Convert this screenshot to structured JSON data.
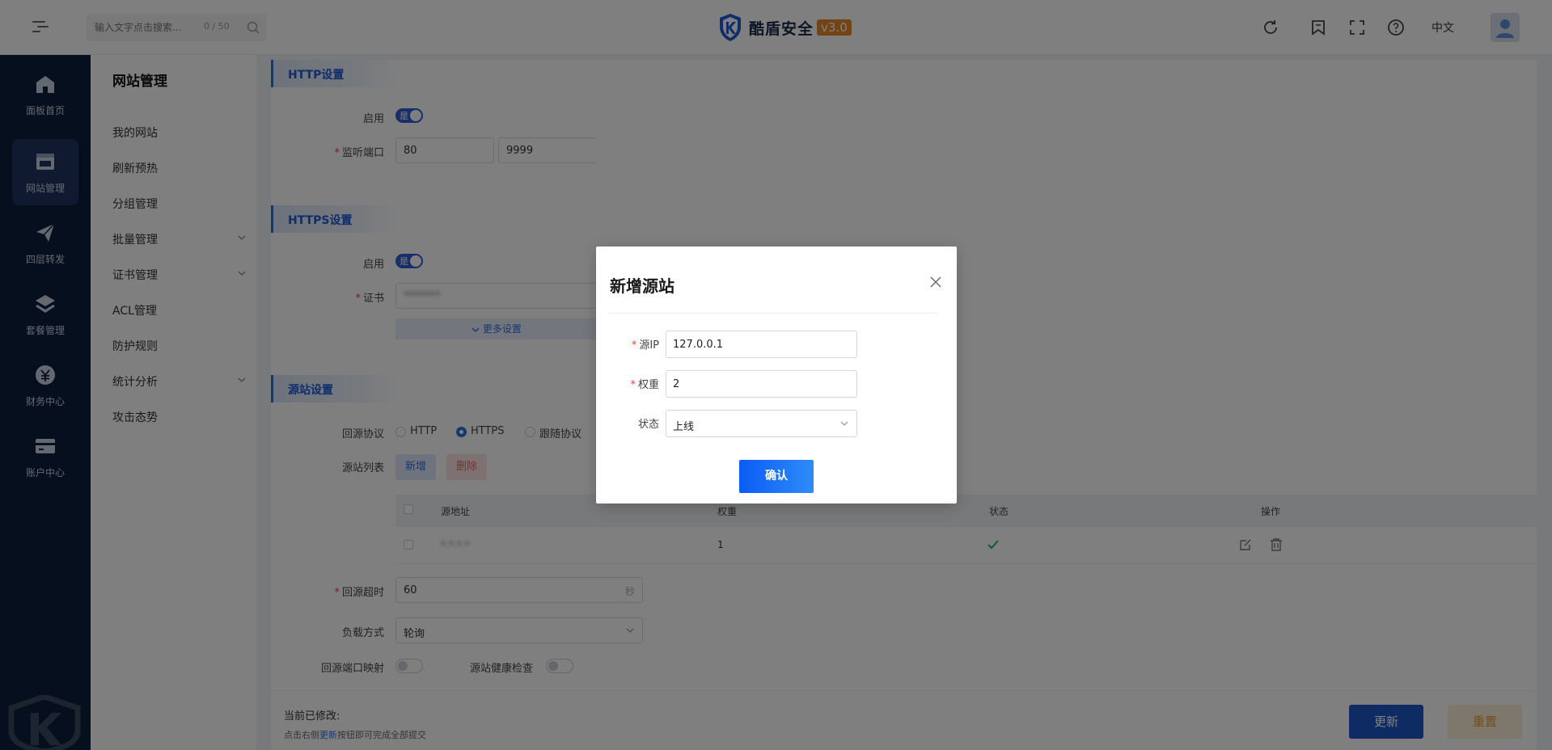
{
  "topbar": {
    "search_placeholder": "输入文字点击搜索...",
    "search_count": "0 / 50",
    "brand_name": "酷盾安全",
    "brand_version": "v3.0",
    "language": "中文"
  },
  "rail": {
    "items": [
      {
        "label": "面板首页",
        "icon": "home-icon"
      },
      {
        "label": "网站管理",
        "icon": "website-icon",
        "active": true
      },
      {
        "label": "四层转发",
        "icon": "paper-plane-icon"
      },
      {
        "label": "套餐管理",
        "icon": "layers-icon"
      },
      {
        "label": "财务中心",
        "icon": "finance-icon"
      },
      {
        "label": "账户中心",
        "icon": "card-icon"
      }
    ]
  },
  "subnav": {
    "title": "网站管理",
    "items": [
      {
        "label": "我的网站"
      },
      {
        "label": "刷新预热"
      },
      {
        "label": "分组管理"
      },
      {
        "label": "批量管理",
        "expandable": true
      },
      {
        "label": "证书管理",
        "expandable": true
      },
      {
        "label": "ACL管理"
      },
      {
        "label": "防护规则"
      },
      {
        "label": "统计分析",
        "expandable": true
      },
      {
        "label": "攻击态势"
      }
    ]
  },
  "http": {
    "title": "HTTP设置",
    "enable_label": "启用",
    "enable_value": "是",
    "port_label": "监听端口",
    "ports": [
      "80",
      "9999"
    ]
  },
  "https": {
    "title": "HTTPS设置",
    "enable_label": "启用",
    "enable_value": "是",
    "cert_label": "证书",
    "cert_value": "*******",
    "more_label": "更多设置"
  },
  "origin": {
    "title": "源站设置",
    "protocol_label": "回源协议",
    "protocols": [
      "HTTP",
      "HTTPS",
      "跟随协议"
    ],
    "selected_protocol": "HTTPS",
    "list_label": "源站列表",
    "add_label": "新增",
    "delete_label": "删除",
    "table": {
      "headers": [
        "源地址",
        "权重",
        "状态",
        "操作"
      ],
      "rows": [
        {
          "address": "*.*.*.*",
          "weight": "1",
          "status": "online"
        }
      ]
    },
    "timeout_label": "回源超时",
    "timeout_value": "60",
    "timeout_unit": "秒",
    "lb_label": "负载方式",
    "lb_value": "轮询",
    "port_map_label": "回源端口映射",
    "health_label": "源站健康检查"
  },
  "footer": {
    "modified_label": "当前已修改:",
    "hint_pre": "点击右侧",
    "hint_link": "更新",
    "hint_post": "按钮即可完成全部提交",
    "update_label": "更新",
    "reset_label": "重置"
  },
  "dialog": {
    "title": "新增源站",
    "ip_label": "源IP",
    "ip_value": "127.0.0.1",
    "weight_label": "权重",
    "weight_value": "2",
    "status_label": "状态",
    "status_value": "上线",
    "confirm_label": "确认"
  },
  "colors": {
    "primary": "#2f6fe0",
    "rail_bg": "#0d1f3d",
    "brand_orange": "#e8882b",
    "danger": "#e04343",
    "success": "#2bb24c"
  }
}
